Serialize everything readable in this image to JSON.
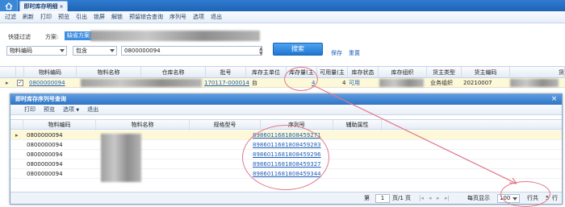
{
  "tabs": {
    "home_icon": "home-icon",
    "active_label": "即时库存明细"
  },
  "menu": [
    "过滤",
    "刷新",
    "打印",
    "预览",
    "引出",
    "锁屏",
    "解锁",
    "预留综合查询",
    "序列号",
    "选项",
    "退出"
  ],
  "filter": {
    "quick_filter_label": "快捷过滤",
    "scheme_label": "方案:",
    "scheme_value": "缺省方案",
    "field_select": "物料编码",
    "op_select": "包含",
    "value": "0800000094",
    "search_label": "搜索",
    "save_label": "保存",
    "reset_label": "重置"
  },
  "grid": {
    "headers": [
      "物料编码",
      "物料名称",
      "仓库名称",
      "批号",
      "库存主单位",
      "库存量(主",
      "可用量(主",
      "库存状态",
      "库存组织",
      "货主类型",
      "货主编码",
      "货"
    ],
    "row": {
      "code": "0800000094",
      "lot": "170117-000014",
      "unit": "台",
      "stock_qty": "4",
      "avail_qty": "4",
      "status": "可用",
      "owner_type": "业务组织",
      "owner_code": "20210007"
    }
  },
  "dialog": {
    "title": "即时库存序列号查询",
    "menu": [
      "打印",
      "预览",
      "选项",
      "退出"
    ],
    "options_caret": "▼",
    "headers": [
      "物料编码",
      "物料名称",
      "规格型号",
      "序列号",
      "辅助属性"
    ],
    "rows": [
      {
        "code": "0800000094",
        "serial": "8986011681808459271"
      },
      {
        "code": "0800000094",
        "serial": "8986011681808459283"
      },
      {
        "code": "0800000094",
        "serial": "8986011681808459296"
      },
      {
        "code": "0800000094",
        "serial": "8986011681808459327"
      },
      {
        "code": "0800000094",
        "serial": "8986011681808459344"
      }
    ],
    "footer": {
      "page_prefix": "第",
      "page_value": "1",
      "page_suffix": "页/1 页",
      "per_page_label": "每页显示",
      "per_page_value": "100",
      "rows_label": "行共",
      "rows_count": "5",
      "rows_suffix": "行"
    }
  },
  "colors": {
    "accent": "#1e76d2",
    "annotation": "#e0788a",
    "row_highlight": "#fdf8d8"
  }
}
